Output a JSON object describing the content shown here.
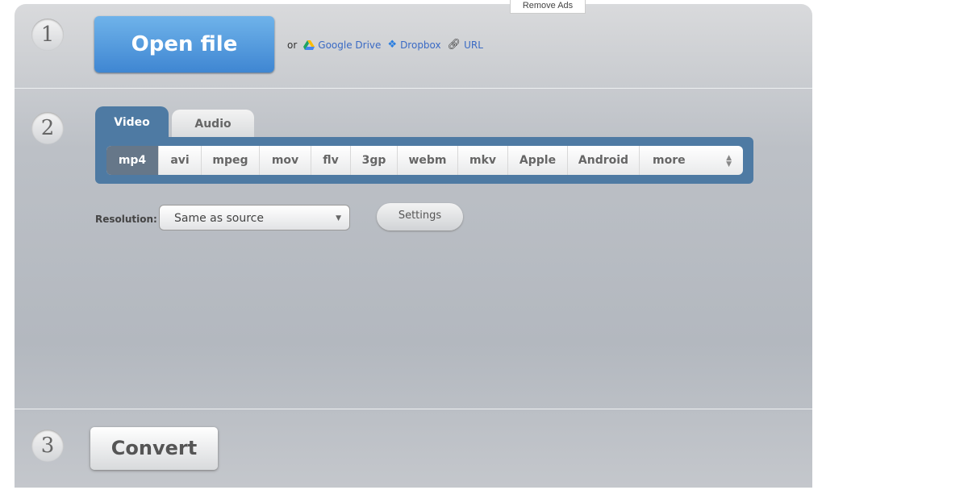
{
  "remove_ads": "Remove Ads",
  "step1": {
    "number": "1",
    "open_file": "Open file",
    "or": "or",
    "google_drive": "Google Drive",
    "dropbox": "Dropbox",
    "url": "URL"
  },
  "step2": {
    "number": "2",
    "tabs": [
      {
        "label": "Video",
        "active": true
      },
      {
        "label": "Audio",
        "active": false
      }
    ],
    "formats": [
      "mp4",
      "avi",
      "mpeg",
      "mov",
      "flv",
      "3gp",
      "webm",
      "mkv",
      "Apple",
      "Android",
      "more"
    ],
    "selected_format": "mp4",
    "resolution_label": "Resolution:",
    "resolution_value": "Same as source",
    "settings": "Settings"
  },
  "step3": {
    "number": "3",
    "convert": "Convert"
  },
  "colors": {
    "accent": "#4e7aa3",
    "open_button": "#4a90dc",
    "link": "#3a6ac4"
  }
}
